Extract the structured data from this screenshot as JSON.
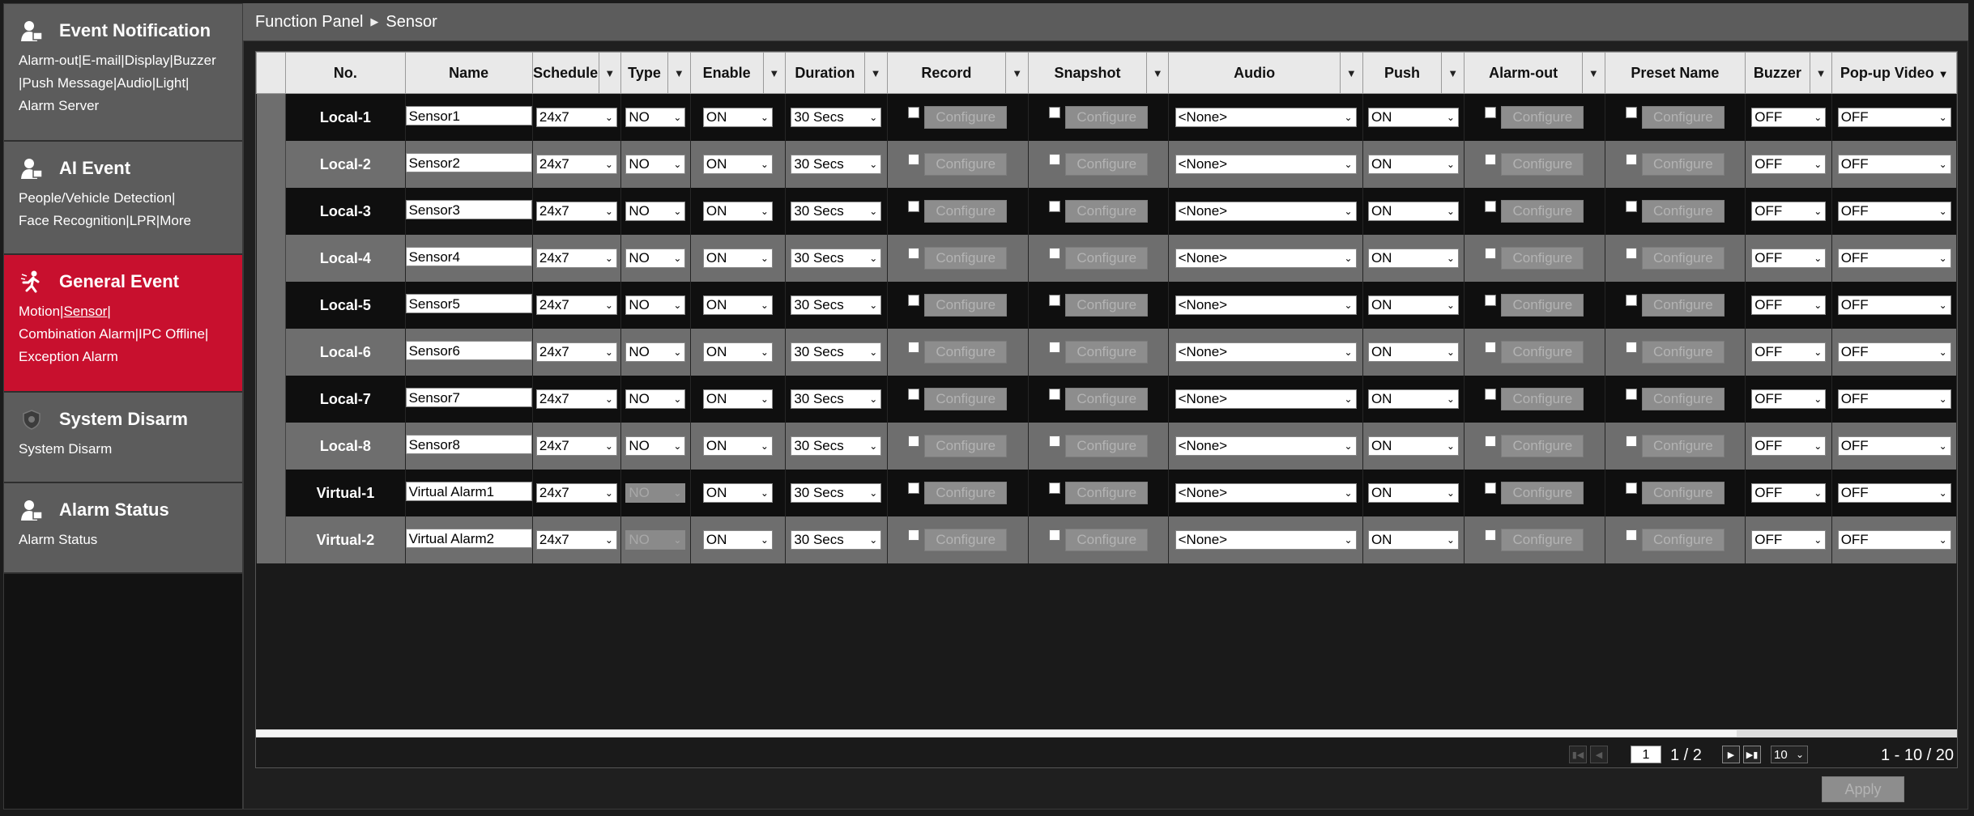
{
  "sidebar": {
    "sections": [
      {
        "title": "Event Notification",
        "icon": "bell-user-icon",
        "links": [
          "Alarm-out|E-mail|Display|Buzzer",
          "|Push Message|Audio|Light|",
          "Alarm Server"
        ]
      },
      {
        "title": "AI Event",
        "icon": "ai-user-icon",
        "links": [
          "People/Vehicle Detection|",
          "Face Recognition|LPR|More"
        ]
      },
      {
        "title": "General Event",
        "icon": "running-person-icon",
        "active": true,
        "line1_a": "Motion|",
        "line1_current": "Sensor",
        "line1_b": "|",
        "links": [
          "Combination Alarm|IPC Offline|",
          "Exception Alarm"
        ]
      },
      {
        "title": "System Disarm",
        "icon": "shield-icon",
        "links": [
          "System Disarm"
        ]
      },
      {
        "title": "Alarm Status",
        "icon": "bell-user-icon",
        "links": [
          "Alarm Status"
        ]
      }
    ]
  },
  "breadcrumb": {
    "root": "Function Panel",
    "current": "Sensor"
  },
  "table": {
    "headers": {
      "no": "No.",
      "name": "Name",
      "schedule": "Schedule",
      "type": "Type",
      "enable": "Enable",
      "duration": "Duration",
      "record": "Record",
      "snapshot": "Snapshot",
      "audio": "Audio",
      "push": "Push",
      "alarm_out": "Alarm-out",
      "preset_name": "Preset Name",
      "buzzer": "Buzzer",
      "popup_video": "Pop-up Video"
    },
    "configure_label": "Configure",
    "rows": [
      {
        "no": "Local-1",
        "name": "Sensor1",
        "schedule": "24x7",
        "type": "NO",
        "enable": "ON",
        "duration": "30 Secs",
        "audio": "<None>",
        "push": "ON",
        "buzzer": "OFF",
        "popup": "OFF"
      },
      {
        "no": "Local-2",
        "name": "Sensor2",
        "schedule": "24x7",
        "type": "NO",
        "enable": "ON",
        "duration": "30 Secs",
        "audio": "<None>",
        "push": "ON",
        "buzzer": "OFF",
        "popup": "OFF"
      },
      {
        "no": "Local-3",
        "name": "Sensor3",
        "schedule": "24x7",
        "type": "NO",
        "enable": "ON",
        "duration": "30 Secs",
        "audio": "<None>",
        "push": "ON",
        "buzzer": "OFF",
        "popup": "OFF"
      },
      {
        "no": "Local-4",
        "name": "Sensor4",
        "schedule": "24x7",
        "type": "NO",
        "enable": "ON",
        "duration": "30 Secs",
        "audio": "<None>",
        "push": "ON",
        "buzzer": "OFF",
        "popup": "OFF"
      },
      {
        "no": "Local-5",
        "name": "Sensor5",
        "schedule": "24x7",
        "type": "NO",
        "enable": "ON",
        "duration": "30 Secs",
        "audio": "<None>",
        "push": "ON",
        "buzzer": "OFF",
        "popup": "OFF"
      },
      {
        "no": "Local-6",
        "name": "Sensor6",
        "schedule": "24x7",
        "type": "NO",
        "enable": "ON",
        "duration": "30 Secs",
        "audio": "<None>",
        "push": "ON",
        "buzzer": "OFF",
        "popup": "OFF"
      },
      {
        "no": "Local-7",
        "name": "Sensor7",
        "schedule": "24x7",
        "type": "NO",
        "enable": "ON",
        "duration": "30 Secs",
        "audio": "<None>",
        "push": "ON",
        "buzzer": "OFF",
        "popup": "OFF"
      },
      {
        "no": "Local-8",
        "name": "Sensor8",
        "schedule": "24x7",
        "type": "NO",
        "enable": "ON",
        "duration": "30 Secs",
        "audio": "<None>",
        "push": "ON",
        "buzzer": "OFF",
        "popup": "OFF"
      },
      {
        "no": "Virtual-1",
        "name": "Virtual Alarm1",
        "schedule": "24x7",
        "type": "NO",
        "type_disabled": true,
        "enable": "ON",
        "duration": "30 Secs",
        "audio": "<None>",
        "push": "ON",
        "buzzer": "OFF",
        "popup": "OFF"
      },
      {
        "no": "Virtual-2",
        "name": "Virtual Alarm2",
        "schedule": "24x7",
        "type": "NO",
        "type_disabled": true,
        "enable": "ON",
        "duration": "30 Secs",
        "audio": "<None>",
        "push": "ON",
        "buzzer": "OFF",
        "popup": "OFF"
      }
    ]
  },
  "pager": {
    "page_input": "1",
    "page_total": "1 / 2",
    "per_page": "10",
    "range": "1 - 10 / 20"
  },
  "apply_label": "Apply",
  "colors": {
    "active_section": "#c8102e",
    "section_bg": "#5c5c5c"
  }
}
